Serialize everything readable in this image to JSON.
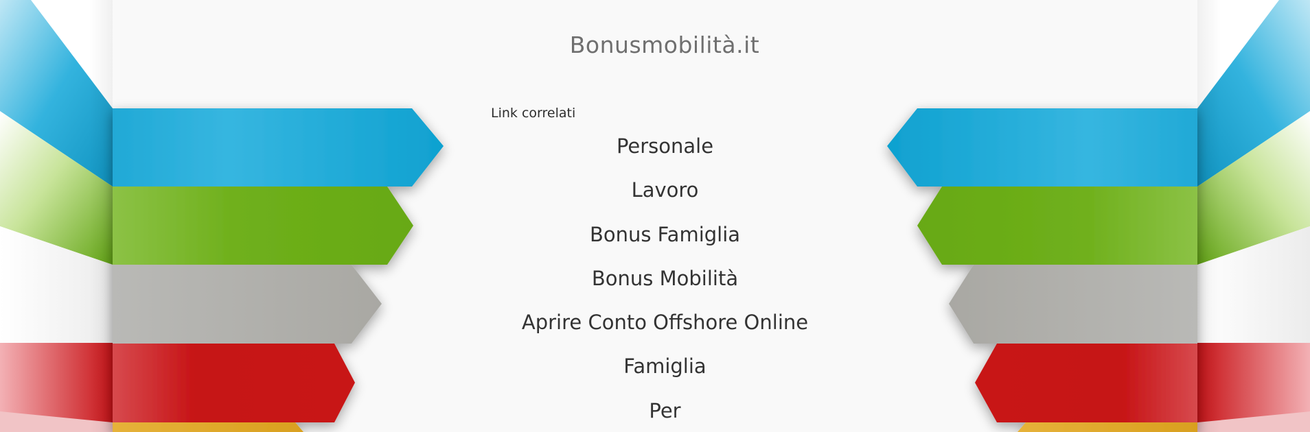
{
  "site": {
    "title": "Bonusmobilità.it"
  },
  "related": {
    "heading": "Link correlati",
    "links": [
      "Personale",
      "Lavoro",
      "Bonus Famiglia",
      "Bonus Mobilità",
      "Aprire Conto Offshore Online",
      "Famiglia",
      "Per"
    ]
  },
  "colors": {
    "panel": "#f9f9f9",
    "ribbon_blue": "#13a6d3",
    "ribbon_green": "#6dae16",
    "ribbon_gray": "#aeada9",
    "ribbon_red": "#c81414",
    "ribbon_yellow": "#e0a825",
    "title_text": "#6f6f6f",
    "link_text": "#333333"
  }
}
